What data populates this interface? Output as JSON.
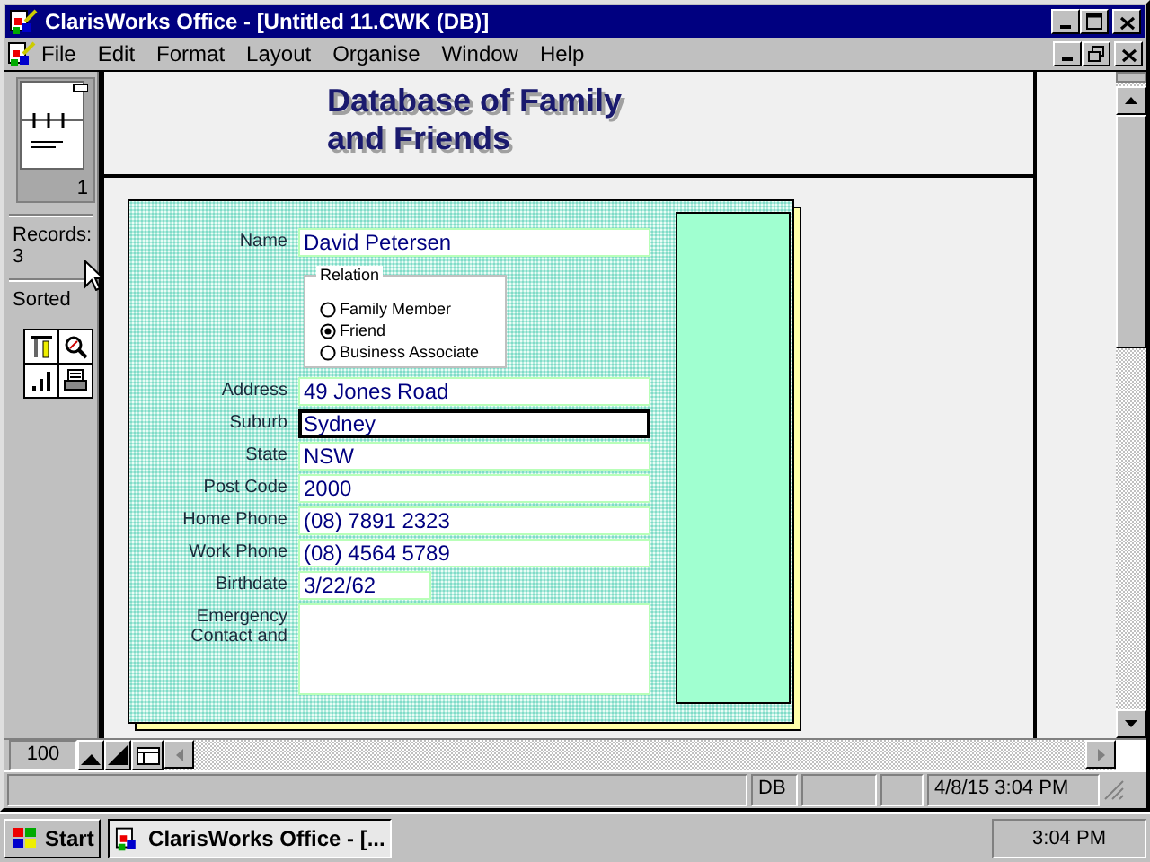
{
  "window": {
    "title": "ClarisWorks Office - [Untitled 11.CWK (DB)]"
  },
  "menu": [
    "File",
    "Edit",
    "Format",
    "Layout",
    "Organise",
    "Window",
    "Help"
  ],
  "sidebar": {
    "page_number": "1",
    "records_label": "Records:",
    "records_count": "3",
    "sort_status": "Sorted"
  },
  "document": {
    "title_lines": [
      "Database of Family",
      "and Friends"
    ],
    "fields": [
      {
        "kind": "text",
        "label": "Name",
        "value": "David Petersen",
        "focused": false
      },
      {
        "kind": "radio_group",
        "label": "Relation",
        "options": [
          {
            "label": "Family Member",
            "selected": false
          },
          {
            "label": "Friend",
            "selected": true
          },
          {
            "label": "Business Associate",
            "selected": false
          }
        ]
      },
      {
        "kind": "text",
        "label": "Address",
        "value": "49 Jones Road",
        "focused": false
      },
      {
        "kind": "text",
        "label": "Suburb",
        "value": "Sydney",
        "focused": true
      },
      {
        "kind": "text",
        "label": "State",
        "value": "NSW",
        "focused": false
      },
      {
        "kind": "text",
        "label": "Post Code",
        "value": "2000",
        "focused": false
      },
      {
        "kind": "text",
        "label": "Home Phone",
        "value": "(08) 7891 2323",
        "focused": false
      },
      {
        "kind": "text",
        "label": "Work Phone",
        "value": "(08) 4564 5789",
        "focused": false
      },
      {
        "kind": "short",
        "label": "Birthdate",
        "value": "3/22/62",
        "focused": false
      },
      {
        "kind": "memo",
        "label": "Emergency Contact and",
        "focused": false
      }
    ]
  },
  "zoom": "100",
  "status_bar": {
    "mode": "DB",
    "datetime": "4/8/15 3:04 PM"
  },
  "taskbar": {
    "start": "Start",
    "task": "ClarisWorks Office - [...",
    "clock": "3:04 PM"
  }
}
